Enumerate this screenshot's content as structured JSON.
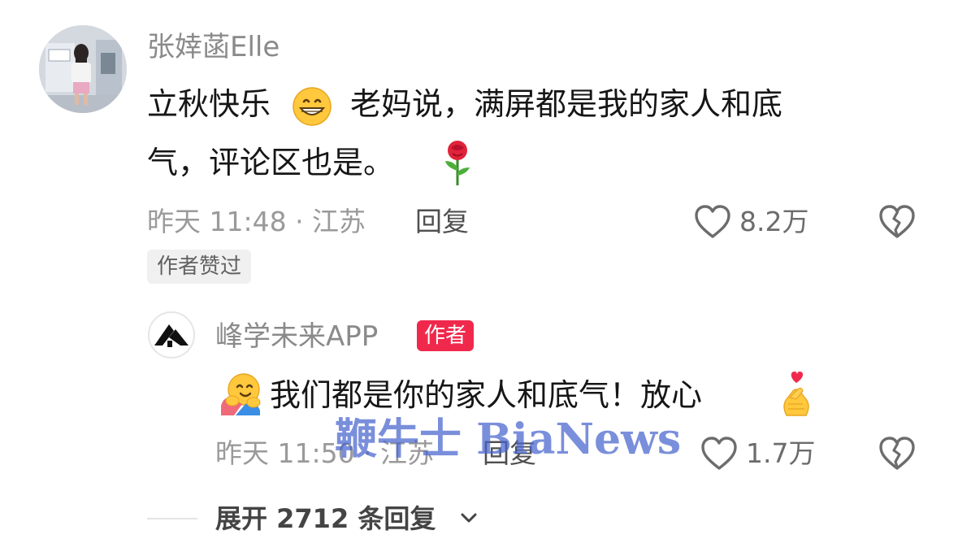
{
  "main_comment": {
    "username": "张婞菡Elle",
    "text_line1": "立秋快乐",
    "text_line1b": "老妈说，满屏都是我的家人和底",
    "text_line2": "气，评论区也是。",
    "emoji_grin": "😁",
    "emoji_rose": "🌹",
    "timestamp_location": "昨天 11:48 · 江苏",
    "reply_label": "回复",
    "like_count": "8.2万",
    "author_liked_tag": "作者赞过"
  },
  "reply": {
    "username": "峰学未来APP",
    "author_badge": "作者",
    "emoji_hug": "🤗",
    "text": "我们都是你的家人和底气！放心",
    "emoji_heart_fingers": "🫰",
    "timestamp_location": "昨天 11:50 · 江苏",
    "reply_label": "回复",
    "like_count": "1.7万"
  },
  "expand": {
    "label": "展开 2712 条回复"
  },
  "watermark": "鞭牛士 BiaNews",
  "icons": {
    "like": "heart-outline-icon",
    "dislike": "broken-heart-icon",
    "expand": "chevron-down-icon"
  },
  "colors": {
    "username": "#8a8a8a",
    "text": "#161616",
    "meta": "#9a9a9a",
    "author_badge_bg": "#f0294c",
    "watermark": "#4664cd"
  }
}
